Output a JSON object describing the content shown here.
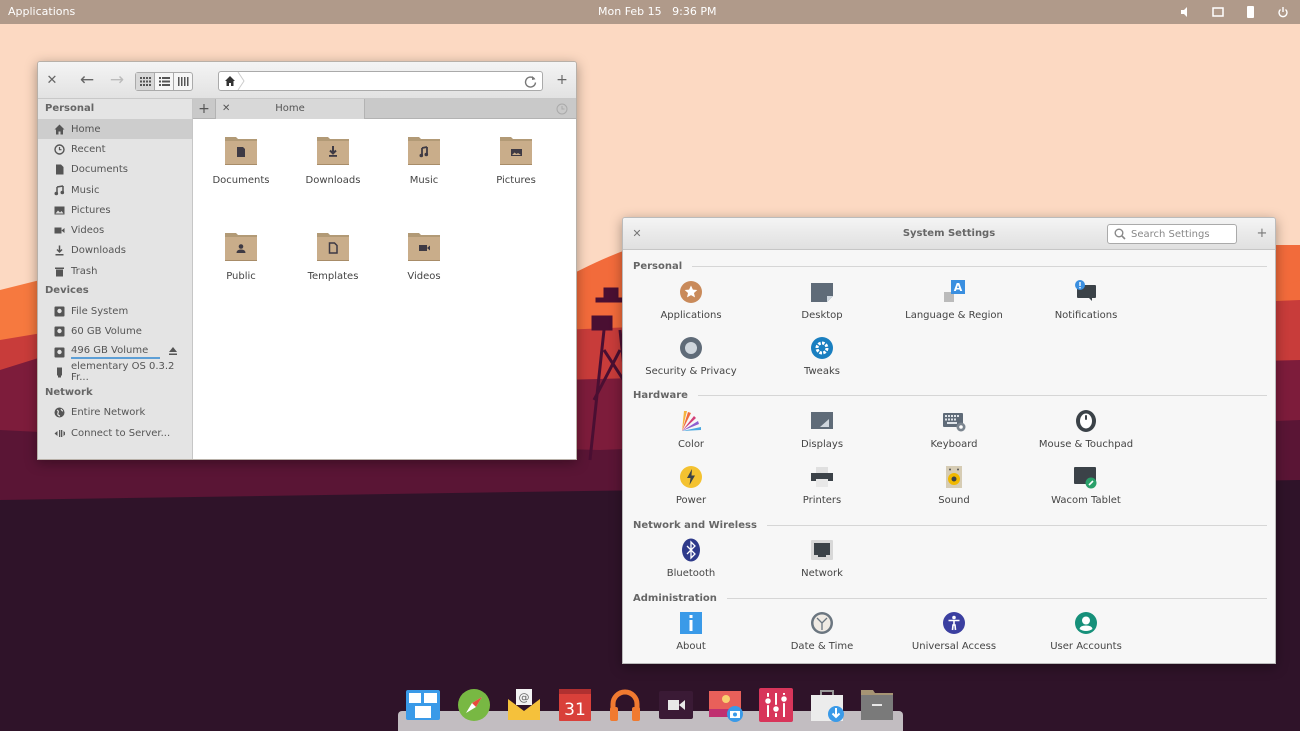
{
  "topbar": {
    "applications_label": "Applications",
    "date": "Mon Feb 15",
    "time": "9:36 PM",
    "indicators": [
      "volume-icon",
      "display-icon",
      "battery-icon",
      "power-icon"
    ]
  },
  "files": {
    "path": "Home",
    "tab_label": "Home",
    "sidebar": {
      "personal_label": "Personal",
      "personal": [
        {
          "label": "Home",
          "icon": "home-icon",
          "selected": true
        },
        {
          "label": "Recent",
          "icon": "clock-icon"
        },
        {
          "label": "Documents",
          "icon": "document-icon"
        },
        {
          "label": "Music",
          "icon": "music-icon"
        },
        {
          "label": "Pictures",
          "icon": "picture-icon"
        },
        {
          "label": "Videos",
          "icon": "video-icon"
        },
        {
          "label": "Downloads",
          "icon": "download-icon"
        },
        {
          "label": "Trash",
          "icon": "trash-icon"
        }
      ],
      "devices_label": "Devices",
      "devices": [
        {
          "label": "File System",
          "icon": "drive-icon"
        },
        {
          "label": "60 GB Volume",
          "icon": "drive-icon"
        },
        {
          "label": "496 GB Volume",
          "icon": "drive-icon",
          "eject": true
        },
        {
          "label": "elementary OS 0.3.2 Fr...",
          "icon": "usb-icon"
        }
      ],
      "network_label": "Network",
      "network": [
        {
          "label": "Entire Network",
          "icon": "globe-icon"
        },
        {
          "label": "Connect to Server...",
          "icon": "server-icon"
        }
      ]
    },
    "folders": [
      {
        "label": "Documents",
        "icon": "document"
      },
      {
        "label": "Downloads",
        "icon": "download"
      },
      {
        "label": "Music",
        "icon": "music"
      },
      {
        "label": "Pictures",
        "icon": "picture"
      },
      {
        "label": "Public",
        "icon": "user"
      },
      {
        "label": "Templates",
        "icon": "template"
      },
      {
        "label": "Videos",
        "icon": "video"
      }
    ]
  },
  "settings": {
    "title": "System Settings",
    "search_placeholder": "Search Settings",
    "categories": [
      {
        "label": "Personal",
        "items": [
          "Applications",
          "Desktop",
          "Language & Region",
          "Notifications",
          "Security & Privacy",
          "Tweaks"
        ]
      },
      {
        "label": "Hardware",
        "items": [
          "Color",
          "Displays",
          "Keyboard",
          "Mouse & Touchpad",
          "Power",
          "Printers",
          "Sound",
          "Wacom Tablet"
        ]
      },
      {
        "label": "Network and Wireless",
        "items": [
          "Bluetooth",
          "Network"
        ]
      },
      {
        "label": "Administration",
        "items": [
          "About",
          "Date & Time",
          "Universal Access",
          "User Accounts"
        ]
      }
    ]
  },
  "dock": {
    "apps": [
      "Multitasking View",
      "Web Browser",
      "Mail",
      "Calendar",
      "Music",
      "Videos",
      "Photos",
      "System Settings",
      "AppCenter",
      "Files"
    ]
  }
}
